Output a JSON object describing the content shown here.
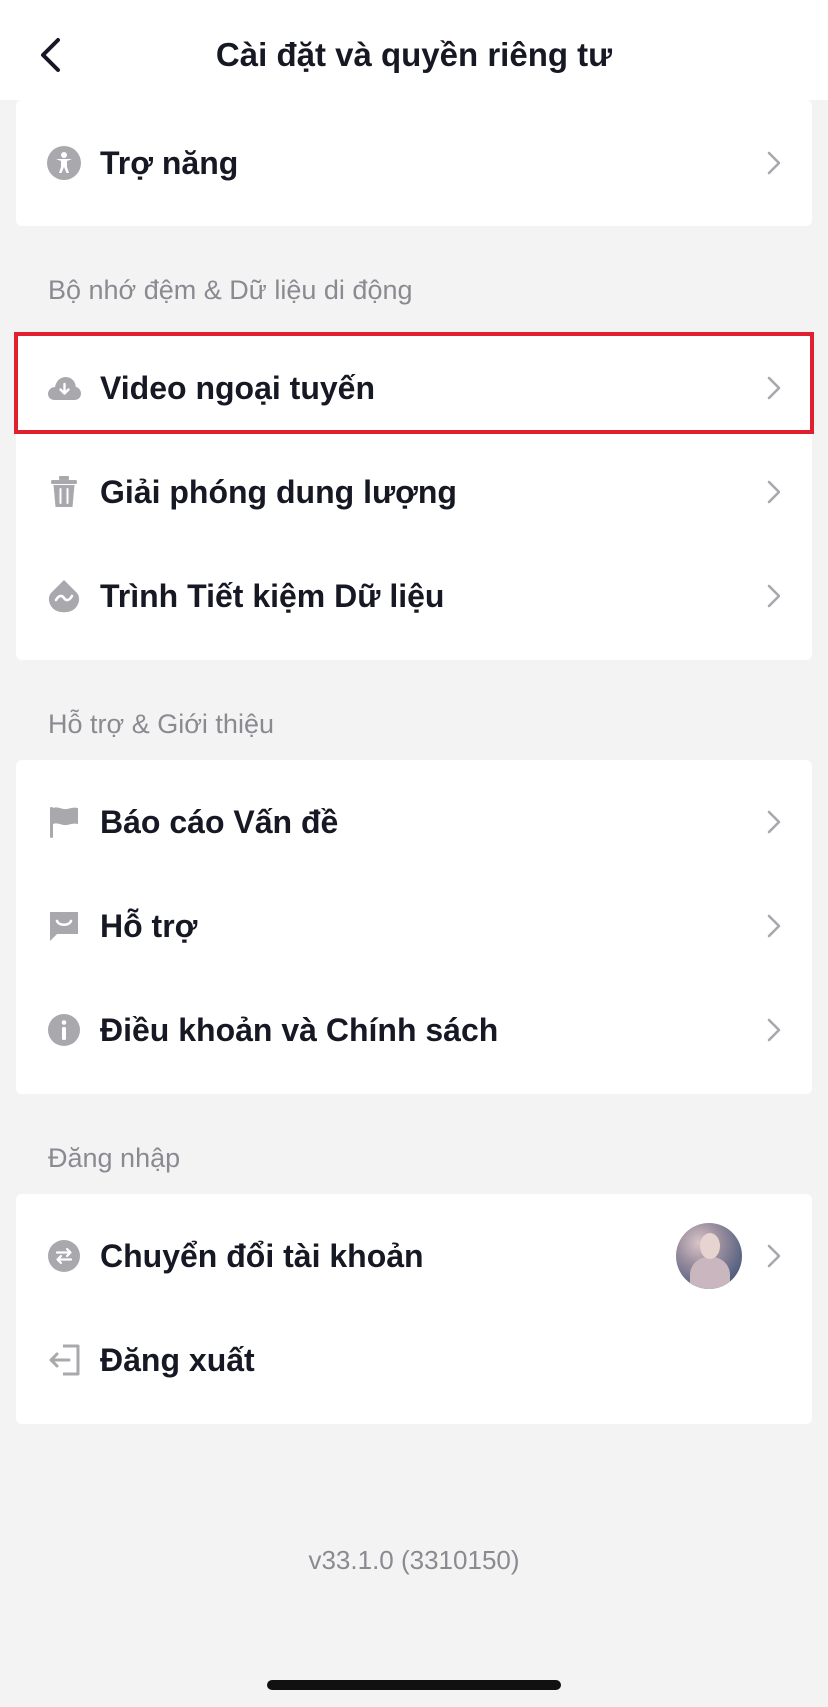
{
  "header": {
    "title": "Cài đặt và quyền riêng tư"
  },
  "top_card": {
    "items": [
      {
        "label": "Trợ năng",
        "icon": "accessibility-icon"
      }
    ]
  },
  "sections": {
    "cache": {
      "title": "Bộ nhớ đệm & Dữ liệu di động",
      "items": [
        {
          "label": "Video ngoại tuyến",
          "icon": "cloud-download-icon",
          "highlighted": true
        },
        {
          "label": "Giải phóng dung lượng",
          "icon": "trash-icon"
        },
        {
          "label": "Trình Tiết kiệm Dữ liệu",
          "icon": "data-saver-icon"
        }
      ]
    },
    "support": {
      "title": "Hỗ trợ & Giới thiệu",
      "items": [
        {
          "label": "Báo cáo Vấn đề",
          "icon": "flag-icon"
        },
        {
          "label": "Hỗ trợ",
          "icon": "chat-icon"
        },
        {
          "label": "Điều khoản và Chính sách",
          "icon": "info-icon"
        }
      ]
    },
    "login": {
      "title": "Đăng nhập",
      "items": [
        {
          "label": "Chuyển đổi tài khoản",
          "icon": "switch-account-icon"
        },
        {
          "label": "Đăng xuất",
          "icon": "logout-icon"
        }
      ]
    }
  },
  "version": "v33.1.0 (3310150)",
  "colors": {
    "background": "#f4f3f4",
    "card": "#ffffff",
    "text": "#161823",
    "secondary_text": "#8a8b91",
    "icon": "#a8a8ad",
    "highlight_border": "#e0202e"
  }
}
